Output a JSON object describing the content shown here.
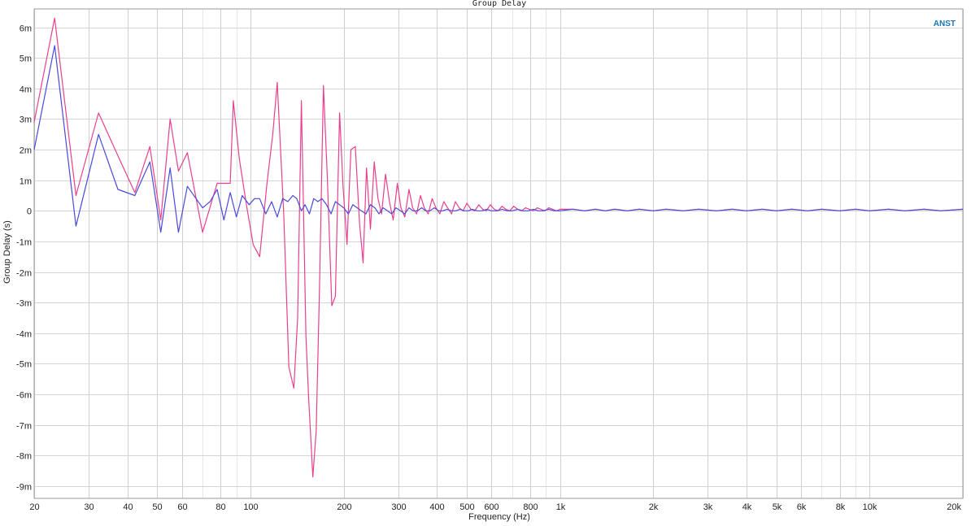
{
  "chart_data": {
    "type": "line",
    "title": "Group Delay",
    "xlabel": "Frequency (Hz)",
    "ylabel": "Group Delay (s)",
    "brand": "ANST",
    "brand_color": "#1a73b8",
    "x_scale": "log",
    "xlim": [
      20,
      20000
    ],
    "ylim": [
      -0.0094,
      0.0066
    ],
    "grid": true,
    "x_ticks": [
      {
        "value": 20,
        "label": "20"
      },
      {
        "value": 30,
        "label": "30"
      },
      {
        "value": 40,
        "label": "40"
      },
      {
        "value": 50,
        "label": "50"
      },
      {
        "value": 60,
        "label": "60"
      },
      {
        "value": 80,
        "label": "80"
      },
      {
        "value": 100,
        "label": "100"
      },
      {
        "value": 200,
        "label": "200"
      },
      {
        "value": 300,
        "label": "300"
      },
      {
        "value": 400,
        "label": "400"
      },
      {
        "value": 500,
        "label": "500"
      },
      {
        "value": 600,
        "label": "600"
      },
      {
        "value": 800,
        "label": "800"
      },
      {
        "value": 1000,
        "label": "1k"
      },
      {
        "value": 2000,
        "label": "2k"
      },
      {
        "value": 3000,
        "label": "3k"
      },
      {
        "value": 4000,
        "label": "4k"
      },
      {
        "value": 5000,
        "label": "5k"
      },
      {
        "value": 6000,
        "label": "6k"
      },
      {
        "value": 8000,
        "label": "8k"
      },
      {
        "value": 10000,
        "label": "10k"
      },
      {
        "value": 20000,
        "label": "20k"
      }
    ],
    "y_ticks": [
      {
        "value": 0.006,
        "label": "6m"
      },
      {
        "value": 0.005,
        "label": "5m"
      },
      {
        "value": 0.004,
        "label": "4m"
      },
      {
        "value": 0.003,
        "label": "3m"
      },
      {
        "value": 0.002,
        "label": "2m"
      },
      {
        "value": 0.001,
        "label": "1m"
      },
      {
        "value": 0,
        "label": "0"
      },
      {
        "value": -0.001,
        "label": "-1m"
      },
      {
        "value": -0.002,
        "label": "-2m"
      },
      {
        "value": -0.003,
        "label": "-3m"
      },
      {
        "value": -0.004,
        "label": "-4m"
      },
      {
        "value": -0.005,
        "label": "-5m"
      },
      {
        "value": -0.006,
        "label": "-6m"
      },
      {
        "value": -0.007,
        "label": "-7m"
      },
      {
        "value": -0.008,
        "label": "-8m"
      },
      {
        "value": -0.009,
        "label": "-9m"
      }
    ],
    "series": [
      {
        "color": "#e8408f",
        "x": [
          20,
          23.3,
          27.3,
          32.3,
          37.3,
          42.3,
          47.3,
          51.3,
          55.0,
          58.5,
          62.5,
          70,
          78,
          86,
          88,
          92,
          97,
          102,
          107,
          113,
          118,
          122,
          128,
          133,
          138,
          142,
          146,
          151,
          154,
          159,
          163,
          167,
          172,
          177,
          183,
          188,
          194,
          199,
          205,
          211,
          218,
          225,
          231,
          237,
          244,
          251,
          258,
          265,
          273,
          281,
          289,
          298,
          306,
          315,
          325,
          334,
          344,
          354,
          364,
          375,
          386,
          397,
          409,
          421,
          433,
          446,
          459,
          472,
          486,
          500,
          515,
          530,
          546,
          562,
          578,
          595,
          613,
          631,
          649,
          668,
          688,
          708,
          729,
          750,
          773,
          795,
          819,
          843,
          867,
          893,
          919,
          946,
          974,
          1000,
          1100,
          1200,
          1300,
          1400,
          1500,
          1650,
          1800,
          2000,
          2200,
          2500,
          2800,
          3200,
          3600,
          4000,
          4500,
          5000,
          5600,
          6300,
          7000,
          8000,
          9000,
          10000,
          11500,
          13000,
          15000,
          17000,
          20000
        ],
        "y": [
          0.0029,
          0.0063,
          0.0005,
          0.0032,
          0.0018,
          0.0006,
          0.0021,
          -0.0003,
          0.003,
          0.0013,
          0.0019,
          -0.0007,
          0.0009,
          0.0009,
          0.0036,
          0.0017,
          0.0002,
          -0.0011,
          -0.0015,
          0.0009,
          0.0025,
          0.0042,
          -0.0001,
          -0.0051,
          -0.0058,
          -0.0035,
          0.0036,
          -0.0041,
          -0.0061,
          -0.0087,
          -0.0072,
          -0.0025,
          0.0041,
          0.0011,
          -0.0031,
          -0.0028,
          0.0032,
          0.0008,
          -0.0011,
          0.002,
          0.0021,
          -0.0004,
          -0.0017,
          0.0014,
          -0.0006,
          0.0016,
          0.0004,
          -0.0001,
          0.0012,
          0.0003,
          -0.0003,
          0.0009,
          0.0001,
          -0.0002,
          0.0007,
          0.0001,
          -0.0001,
          0.0005,
          0.0001,
          -0.0001,
          0.0004,
          0.0001,
          -0.0001,
          0.0003,
          0.0001,
          -0.0001,
          0.0003,
          0.0001,
          0.0,
          0.00025,
          5e-05,
          0.0,
          0.0002,
          5e-05,
          0.0,
          0.0002,
          5e-05,
          0.0,
          0.00015,
          5e-05,
          0.0,
          0.00015,
          5e-05,
          0.0,
          0.0001,
          5e-05,
          0.0,
          0.0001,
          5e-05,
          0.0,
          0.0001,
          5e-05,
          0.0,
          5e-05,
          5e-05,
          0.0,
          5e-05,
          0.0,
          5e-05,
          0.0,
          5e-05,
          0.0,
          5e-05,
          0.0,
          5e-05,
          0.0,
          5e-05,
          0.0,
          5e-05,
          0.0,
          5e-05,
          0.0,
          5e-05,
          0.0,
          5e-05,
          0.0,
          5e-05,
          0.0,
          5e-05,
          0.0,
          5e-05
        ]
      },
      {
        "color": "#4a4ad8",
        "x": [
          20,
          23.3,
          27.3,
          32.3,
          37.3,
          42.3,
          47.3,
          51.3,
          55.0,
          58.5,
          62.5,
          70,
          74,
          78,
          82,
          86,
          90,
          94,
          99,
          103,
          107,
          112,
          117,
          122,
          127,
          132,
          137,
          141,
          146,
          150,
          155,
          160,
          165,
          170,
          176,
          182,
          188,
          194,
          200,
          207,
          214,
          221,
          228,
          236,
          244,
          252,
          260,
          268,
          277,
          286,
          295,
          305,
          315,
          325,
          335,
          346,
          357,
          368,
          380,
          392,
          405,
          418,
          431,
          445,
          460,
          475,
          490,
          505,
          520,
          540,
          560,
          580,
          600,
          625,
          650,
          675,
          700,
          730,
          760,
          790,
          820,
          850,
          880,
          920,
          960,
          1000,
          1100,
          1200,
          1300,
          1400,
          1500,
          1650,
          1800,
          2000,
          2200,
          2500,
          2800,
          3200,
          3600,
          4000,
          4500,
          5000,
          5600,
          6300,
          7000,
          8000,
          9000,
          10000,
          11500,
          13000,
          15000,
          17000,
          20000
        ],
        "y": [
          0.002,
          0.0054,
          -0.0005,
          0.0025,
          0.0007,
          0.0005,
          0.0016,
          -0.0007,
          0.0014,
          -0.0007,
          0.0008,
          0.0001,
          0.0003,
          0.0007,
          -0.0003,
          0.0006,
          -0.0002,
          0.0005,
          0.0002,
          0.0004,
          0.0004,
          -0.0001,
          0.0003,
          -0.0002,
          0.0004,
          0.0003,
          0.0005,
          0.0004,
          0.0,
          0.0002,
          -0.0001,
          0.0004,
          0.0003,
          0.0004,
          0.0002,
          -0.0001,
          0.0003,
          0.0002,
          0.0001,
          -0.0001,
          0.0002,
          0.0001,
          0.0,
          -0.0001,
          0.0002,
          0.0001,
          -0.0001,
          0.0001,
          0.0,
          -0.0001,
          0.0001,
          0.0,
          -0.0001,
          0.0001,
          0.0,
          0.0,
          0.0001,
          0.0,
          0.0,
          0.0001,
          0.0,
          0.0,
          5e-05,
          0.0,
          0.0,
          5e-05,
          0.0,
          0.0,
          5e-05,
          0.0,
          0.0,
          5e-05,
          0.0,
          0.0,
          5e-05,
          0.0,
          0.0,
          5e-05,
          0.0,
          0.0,
          5e-05,
          0.0,
          0.0,
          5e-05,
          0.0,
          0.0,
          5e-05,
          0.0,
          5e-05,
          0.0,
          5e-05,
          0.0,
          5e-05,
          0.0,
          5e-05,
          0.0,
          5e-05,
          0.0,
          5e-05,
          0.0,
          5e-05,
          0.0,
          5e-05,
          0.0,
          5e-05,
          0.0,
          5e-05,
          0.0,
          5e-05,
          0.0,
          5e-05,
          0.0,
          5e-05
        ]
      }
    ]
  }
}
